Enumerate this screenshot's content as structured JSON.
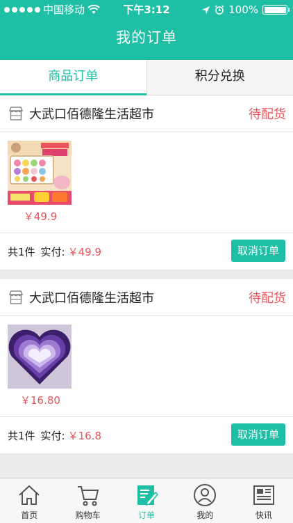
{
  "status_bar": {
    "carrier": "中国移动",
    "time": "下午3:12",
    "battery": "100%"
  },
  "header": {
    "title": "我的订单"
  },
  "tabs": [
    {
      "label": "商品订单",
      "active": true
    },
    {
      "label": "积分兑换",
      "active": false
    }
  ],
  "orders": [
    {
      "store": "大武口佰德隆生活超市",
      "status": "待配货",
      "item_image": "macaron-gift-box",
      "item_price": "￥49.9",
      "count": "共1件",
      "paid_label": "实付:",
      "paid_amount": "￥49.9",
      "cancel_label": "取消订单"
    },
    {
      "store": "大武口佰德隆生活超市",
      "status": "待配货",
      "item_image": "heart-rose-soap-box",
      "item_price": "￥16.80",
      "count": "共1件",
      "paid_label": "实付:",
      "paid_amount": "￥16.8",
      "cancel_label": "取消订单"
    }
  ],
  "tab_bar": [
    {
      "label": "首页",
      "icon": "home-icon",
      "active": false
    },
    {
      "label": "购物车",
      "icon": "cart-icon",
      "active": false
    },
    {
      "label": "订单",
      "icon": "order-edit-icon",
      "active": true
    },
    {
      "label": "我的",
      "icon": "user-icon",
      "active": false
    },
    {
      "label": "快讯",
      "icon": "news-icon",
      "active": false
    }
  ],
  "colors": {
    "accent": "#1fbfa6",
    "price": "#e8545a",
    "background": "#ededed"
  }
}
